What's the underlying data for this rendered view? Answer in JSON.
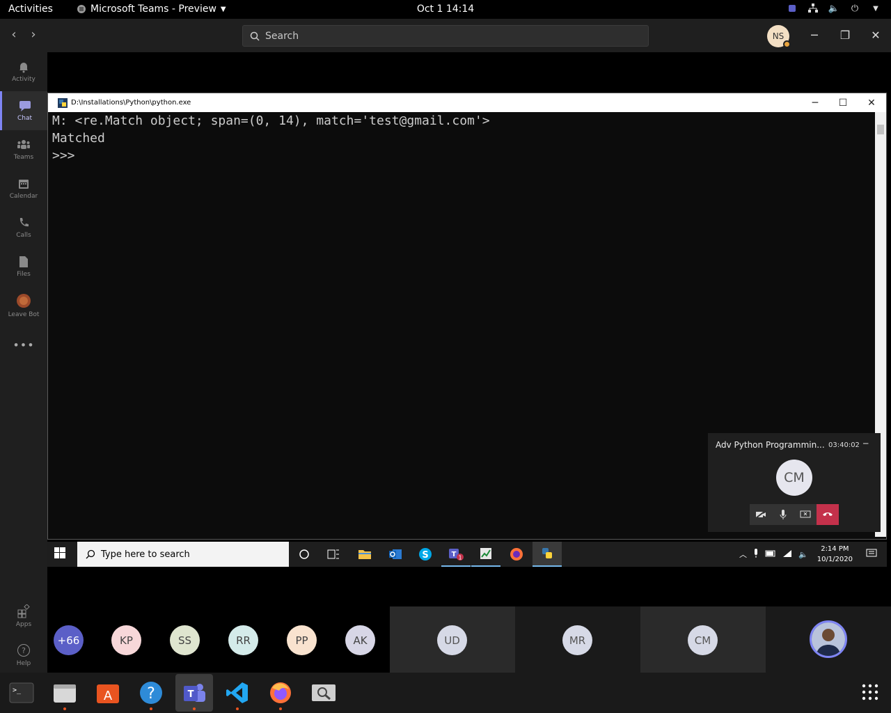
{
  "topbar": {
    "activities": "Activities",
    "app_menu": "Microsoft Teams - Preview",
    "clock": "Oct 1  14:14"
  },
  "teams": {
    "search_placeholder": "Search",
    "me_initials": "NS",
    "rail": [
      {
        "label": "Activity",
        "icon": "bell-icon"
      },
      {
        "label": "Chat",
        "icon": "chat-icon"
      },
      {
        "label": "Teams",
        "icon": "teams-icon"
      },
      {
        "label": "Calendar",
        "icon": "calendar-icon"
      },
      {
        "label": "Calls",
        "icon": "phone-icon"
      },
      {
        "label": "Files",
        "icon": "file-icon"
      },
      {
        "label": "Leave Bot",
        "icon": "bot-icon"
      },
      {
        "label": "Apps",
        "icon": "apps-icon"
      },
      {
        "label": "Help",
        "icon": "help-icon"
      }
    ]
  },
  "python_window": {
    "title": "D:\\Installations\\Python\\python.exe",
    "lines": [
      "M: <re.Match object; span=(0, 14), match='test@gmail.com'>",
      "Matched",
      ">>>"
    ]
  },
  "mini_meeting": {
    "title": "Adv Python Programmin...",
    "duration": "03:40:02",
    "initials": "CM"
  },
  "windows_taskbar": {
    "search_placeholder": "Type here to search",
    "time": "2:14 PM",
    "date": "10/1/2020",
    "teams_badge": "1"
  },
  "participants": {
    "overflow": "+66",
    "bubbles": [
      {
        "initials": "KP",
        "color": "#f7d7d9"
      },
      {
        "initials": "SS",
        "color": "#dfe5cf"
      },
      {
        "initials": "RR",
        "color": "#d4ebea"
      },
      {
        "initials": "PP",
        "color": "#f9e3cf"
      },
      {
        "initials": "AK",
        "color": "#d7d6e6"
      }
    ],
    "tiles": [
      {
        "initials": "UD"
      },
      {
        "initials": "MR"
      },
      {
        "initials": "CM"
      }
    ]
  }
}
